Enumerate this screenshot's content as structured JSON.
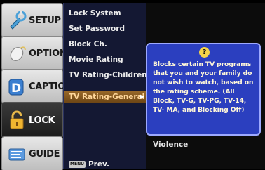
{
  "tabs": [
    {
      "label": "SETUP",
      "icon": "setup-icon"
    },
    {
      "label": "OPTION",
      "icon": "option-icon"
    },
    {
      "label": "CAPTION",
      "icon": "caption-icon"
    },
    {
      "label": "LOCK",
      "icon": "lock-icon",
      "active": true
    },
    {
      "label": "GUIDE",
      "icon": "guide-icon"
    }
  ],
  "menu": {
    "items": [
      "Lock System",
      "Set Password",
      "Block Ch.",
      "Movie Rating",
      "TV Rating-Children",
      "TV Rating-General"
    ],
    "selected_index": 5,
    "footer_key": "MENU",
    "footer_label": "Prev."
  },
  "right": {
    "item": "Violence"
  },
  "tooltip": {
    "icon_glyph": "?",
    "text": "Blocks certain TV programs that you and your family do not wish to watch, based on the rating scheme. (All Block, TV-G, TV-PG, TV-14, TV- MA, and Blocking Off)"
  },
  "colors": {
    "menu_bg": "#141833",
    "selected_bg": "#9b6a2a",
    "tooltip_bg": "#2b3fbf",
    "tooltip_border": "#9da9ff"
  }
}
